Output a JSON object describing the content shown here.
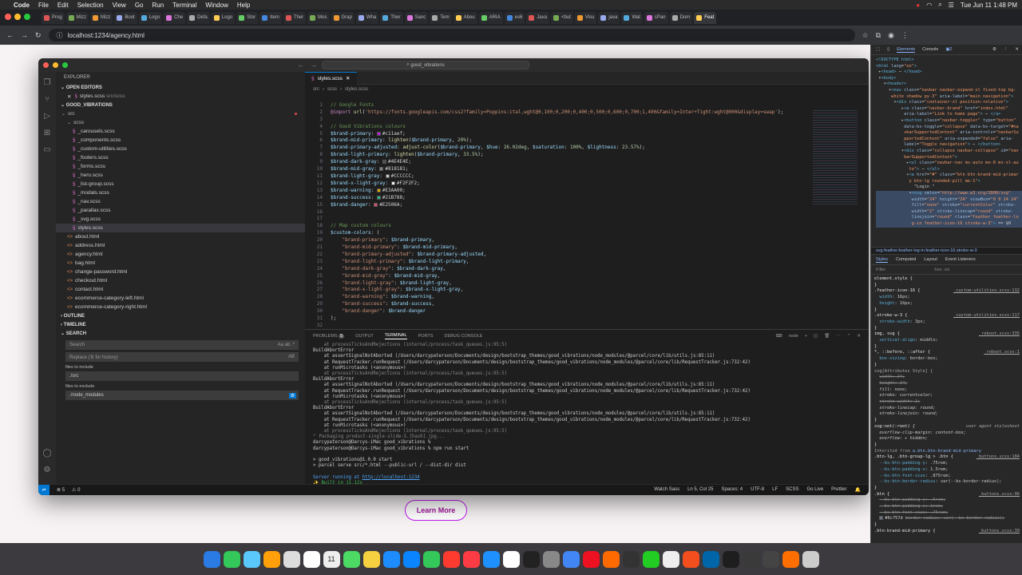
{
  "menubar": {
    "app": "Code",
    "items": [
      "File",
      "Edit",
      "Selection",
      "View",
      "Go",
      "Run",
      "Terminal",
      "Window",
      "Help"
    ],
    "clock": "Tue Jun 11  1:48 PM"
  },
  "browser": {
    "tabs": [
      "Prog",
      "Mizz",
      "Mizz",
      "Boot",
      "Logo",
      "Che",
      "Defa",
      "Logo",
      "Stor",
      "Item",
      "Ther",
      "Mos",
      "Grap",
      "Wha",
      "Ther",
      "Sanc",
      "Tem",
      "Abou",
      "ARIA",
      "es6",
      "Java",
      "<but",
      "Visu",
      "java",
      "Wat",
      "cPan",
      "Dom",
      "Feat"
    ],
    "url": "localhost:1234/agency.html",
    "learn_more": "Learn More"
  },
  "vscode": {
    "command_center": "good_vibrations",
    "explorer_title": "EXPLORER",
    "open_editors": "OPEN EDITORS",
    "open_file": "styles.scss",
    "open_file_path": "src/scss",
    "project": "GOOD_VIBRATIONS",
    "tree": [
      {
        "label": "src",
        "kind": "folder",
        "depth": 1
      },
      {
        "label": "scss",
        "kind": "folder",
        "depth": 2
      },
      {
        "label": "_carousels.scss",
        "kind": "scss",
        "depth": 3
      },
      {
        "label": "_components.scss",
        "kind": "scss",
        "depth": 3
      },
      {
        "label": "_custom-utilities.scss",
        "kind": "scss",
        "depth": 3
      },
      {
        "label": "_footers.scss",
        "kind": "scss",
        "depth": 3
      },
      {
        "label": "_forms.scss",
        "kind": "scss",
        "depth": 3
      },
      {
        "label": "_hero.scss",
        "kind": "scss",
        "depth": 3
      },
      {
        "label": "_list-group.scss",
        "kind": "scss",
        "depth": 3
      },
      {
        "label": "_modals.scss",
        "kind": "scss",
        "depth": 3
      },
      {
        "label": "_nav.scss",
        "kind": "scss",
        "depth": 3
      },
      {
        "label": "_parallax.scss",
        "kind": "scss",
        "depth": 3
      },
      {
        "label": "_svg.scss",
        "kind": "scss",
        "depth": 3
      },
      {
        "label": "styles.scss",
        "kind": "scss",
        "depth": 3,
        "selected": true
      },
      {
        "label": "about.html",
        "kind": "html",
        "depth": 2
      },
      {
        "label": "address.html",
        "kind": "html",
        "depth": 2
      },
      {
        "label": "agency.html",
        "kind": "html",
        "depth": 2
      },
      {
        "label": "bag.html",
        "kind": "html",
        "depth": 2
      },
      {
        "label": "change-password.html",
        "kind": "html",
        "depth": 2
      },
      {
        "label": "checkout.html",
        "kind": "html",
        "depth": 2
      },
      {
        "label": "contact.html",
        "kind": "html",
        "depth": 2
      },
      {
        "label": "ecommerce-category-left.html",
        "kind": "html",
        "depth": 2
      },
      {
        "label": "ecommerce-category-right.html",
        "kind": "html",
        "depth": 2
      }
    ],
    "outline": "OUTLINE",
    "timeline": "TIMELINE",
    "search": "SEARCH",
    "search_placeholder": "Search",
    "replace_placeholder": "Replace (⇅ for history)",
    "files_include_label": "files to include",
    "files_include": "./src",
    "files_exclude_label": "files to exclude",
    "files_exclude": "./node_modules",
    "breadcrumb": [
      "src",
      "scss",
      "styles.scss"
    ],
    "panel_tabs": [
      "PROBLEMS",
      "OUTPUT",
      "TERMINAL",
      "PORTS",
      "DEBUG CONSOLE"
    ],
    "problems_count": "5",
    "terminal_name": "node",
    "status": {
      "errors": "⊗ 5",
      "warnings": "⚠ 0",
      "watch": "Watch Sass",
      "pos": "Ln 5, Col 25",
      "spaces": "Spaces: 4",
      "enc": "UTF-8",
      "eol": "LF",
      "lang": "SCSS",
      "golive": "Go Live",
      "prettier": "Prettier"
    }
  },
  "devtools": {
    "tabs": [
      "Elements",
      "Console"
    ],
    "breadcrumb": "svg.feather.feather-log-in.feather-icon-16.stroke-w-3",
    "style_tabs": [
      "Styles",
      "Computed",
      "Layout",
      "Event Listeners"
    ],
    "filter": "Filter",
    "filter_right": ":hov  .cls"
  },
  "dock": {
    "date": "11"
  }
}
